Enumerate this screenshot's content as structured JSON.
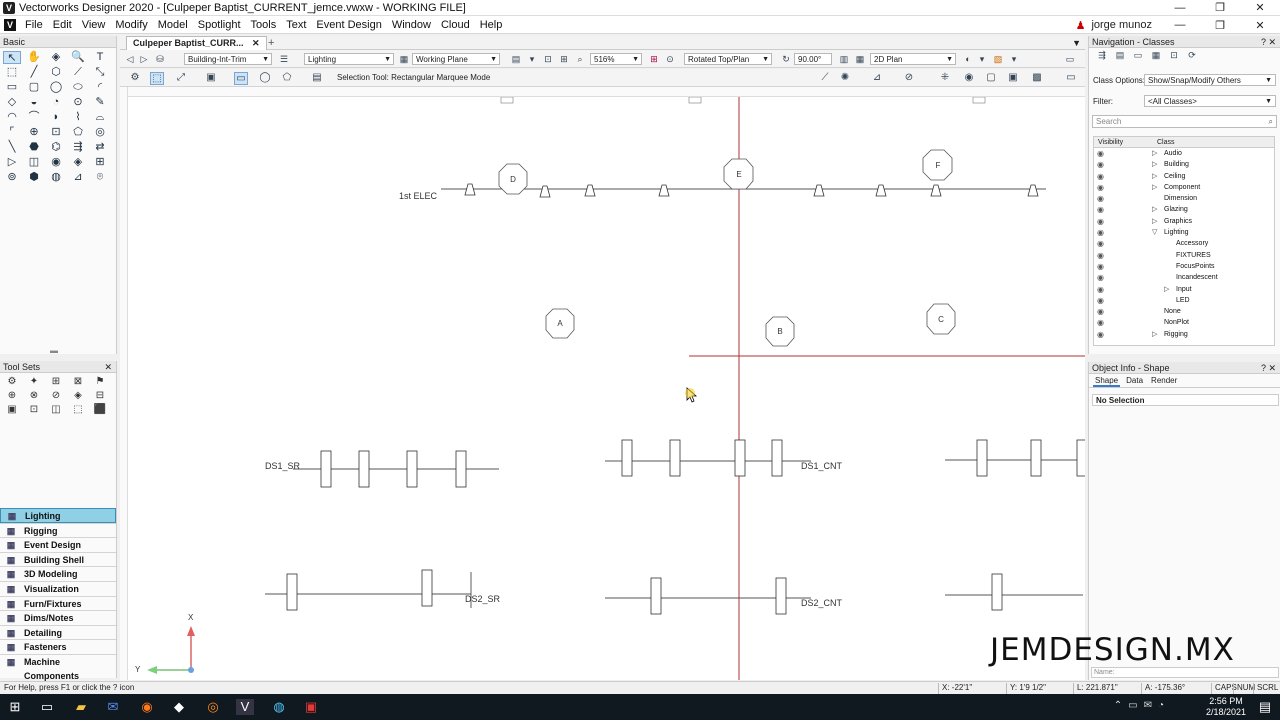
{
  "window": {
    "title": "Vectorworks Designer 2020 - [Culpeper Baptist_CURRENT_jemce.vwxw - WORKING FILE]",
    "min": "—",
    "max": "❐",
    "close": "✕"
  },
  "menu": {
    "items": [
      "File",
      "Edit",
      "View",
      "Modify",
      "Model",
      "Spotlight",
      "Tools",
      "Text",
      "Event Design",
      "Window",
      "Cloud",
      "Help"
    ],
    "user": "jorge munoz"
  },
  "basic_palette": {
    "title": "Basic",
    "tools": [
      "↖",
      "✋",
      "◈",
      "🔍",
      "T",
      "⬚",
      "╱",
      "⬡",
      "⟋",
      "⤡",
      "▭",
      "▢",
      "◯",
      "⬭",
      "◜",
      "◇",
      "◒",
      "◔",
      "⊙",
      "✎",
      "◠",
      "⌒",
      "◗",
      "⌇",
      "⌓",
      "⌜",
      "⊕",
      "⊡",
      "⬠",
      "◎",
      "╲",
      "⬣",
      "⌬",
      "⇶",
      "⇄",
      "▷",
      "◫",
      "◉",
      "◈",
      "⊞",
      "⊚",
      "⬢",
      "◍",
      "⊿",
      "⌾"
    ]
  },
  "toolsets_palette": {
    "title": "Tool Sets",
    "tools": [
      "⚙",
      "✦",
      "⊞",
      "⊠",
      "⚑",
      "⊕",
      "⊗",
      "⊘",
      "◈",
      "⊟",
      "▣",
      "⊡",
      "◫",
      "⬚",
      "⬛"
    ]
  },
  "categories": [
    {
      "label": "Lighting",
      "active": true
    },
    {
      "label": "Rigging",
      "active": false
    },
    {
      "label": "Event Design",
      "active": false
    },
    {
      "label": "Building Shell",
      "active": false
    },
    {
      "label": "3D Modeling",
      "active": false
    },
    {
      "label": "Visualization",
      "active": false
    },
    {
      "label": "Furn/Fixtures",
      "active": false
    },
    {
      "label": "Dims/Notes",
      "active": false
    },
    {
      "label": "Detailing",
      "active": false
    },
    {
      "label": "Fasteners",
      "active": false
    },
    {
      "label": "Machine Components",
      "active": false
    }
  ],
  "doc": {
    "tab_label": "Culpeper Baptist_CURR...",
    "tab_close": "✕",
    "plus": "+",
    "class_value": "Building-Int-Trim",
    "layer_value": "Lighting",
    "plane_value": "Working Plane",
    "zoom_value": "516%",
    "view_value": "Rotated Top/Plan",
    "angle_value": "90.00°",
    "render_value": "2D Plan",
    "mode_text": "Selection Tool: Rectangular Marquee Mode"
  },
  "drawing": {
    "labels": [
      "1st ELEC",
      "DS1_SR",
      "DS1_CNT",
      "DS2_SR",
      "DS2_CNT"
    ],
    "circles": [
      "D",
      "E",
      "F",
      "A",
      "B",
      "C"
    ]
  },
  "nav_panel": {
    "title": "Navigation - Classes",
    "class_options_label": "Class Options:",
    "class_options_value": "Show/Snap/Modify Others",
    "filter_label": "Filter:",
    "filter_value": "<All Classes>",
    "search_placeholder": "Search",
    "col_visibility": "Visibility",
    "col_class": "Class",
    "classes": [
      {
        "name": "Audio",
        "indent": 1,
        "toggle": "▷"
      },
      {
        "name": "Building",
        "indent": 1,
        "toggle": "▷"
      },
      {
        "name": "Ceiling",
        "indent": 1,
        "toggle": "▷"
      },
      {
        "name": "Component",
        "indent": 1,
        "toggle": "▷"
      },
      {
        "name": "Dimension",
        "indent": 1,
        "toggle": ""
      },
      {
        "name": "Glazing",
        "indent": 1,
        "toggle": "▷"
      },
      {
        "name": "Graphics",
        "indent": 1,
        "toggle": "▷"
      },
      {
        "name": "Lighting",
        "indent": 1,
        "toggle": "▽"
      },
      {
        "name": "Accessory",
        "indent": 2,
        "toggle": ""
      },
      {
        "name": "FIXTURES",
        "indent": 2,
        "toggle": ""
      },
      {
        "name": "FocusPoints",
        "indent": 2,
        "toggle": ""
      },
      {
        "name": "Incandescent",
        "indent": 2,
        "toggle": ""
      },
      {
        "name": "Input",
        "indent": 2,
        "toggle": "▷"
      },
      {
        "name": "LED",
        "indent": 2,
        "toggle": ""
      },
      {
        "name": "None",
        "indent": 1,
        "toggle": ""
      },
      {
        "name": "NonPlot",
        "indent": 1,
        "toggle": ""
      },
      {
        "name": "Rigging",
        "indent": 1,
        "toggle": "▷"
      }
    ]
  },
  "object_info": {
    "title": "Object Info - Shape",
    "tabs": [
      "Shape",
      "Data",
      "Render"
    ],
    "selection": "No Selection",
    "name_placeholder": "Name:"
  },
  "watermark": "JEMDESIGN.MX",
  "status": {
    "help": "For Help, press F1 or click the ? icon",
    "x": "X: -22'1\"",
    "y": "Y: 1'9 1/2\"",
    "l": "L: 221.871\"",
    "a": "A: -175.36°",
    "caps": "CAPS",
    "num": "NUM",
    "scrl": "SCRL"
  },
  "taskbar": {
    "time": "2:56 PM",
    "date": "2/18/2021"
  },
  "colors": {
    "accent": "#3a8fb5",
    "active_category": "#8fd0e6",
    "crosshair": "#c0392b"
  }
}
